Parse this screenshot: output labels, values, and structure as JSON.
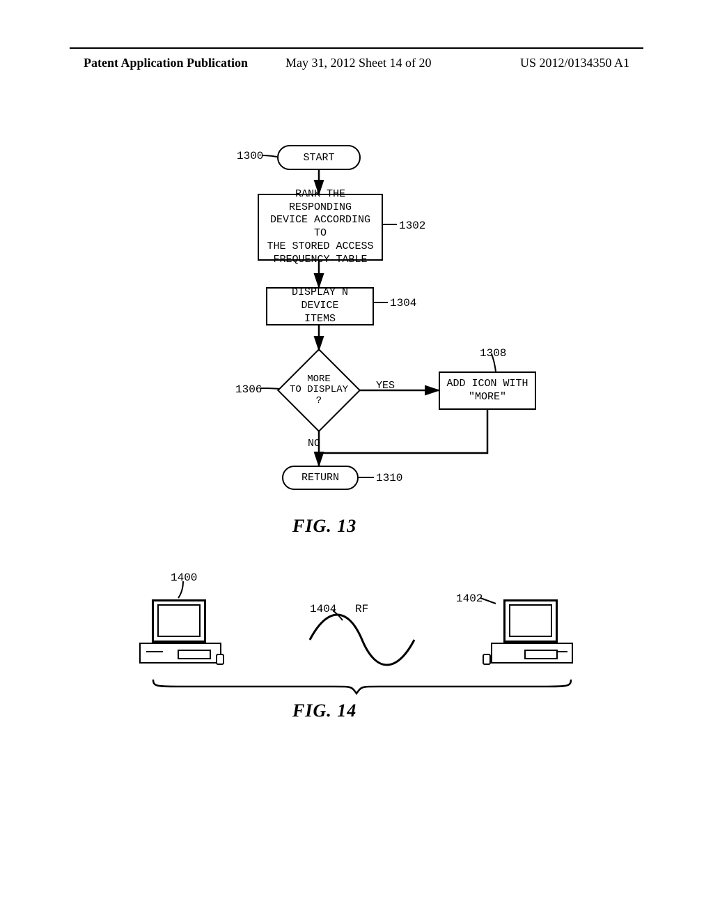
{
  "header": {
    "left": "Patent Application Publication",
    "mid": "May 31, 2012  Sheet 14 of 20",
    "right": "US 2012/0134350 A1"
  },
  "fig13": {
    "start_label": "START",
    "box_rank": "RANK THE RESPONDING\nDEVICE ACCORDING TO\nTHE STORED ACCESS\nFREQUENCY TABLE",
    "box_display": "DISPLAY N DEVICE\nITEMS",
    "decision": "MORE\nTO DISPLAY\n?",
    "decision_yes": "YES",
    "decision_no": "NO",
    "box_more": "ADD ICON WITH\n\"MORE\"",
    "return_label": "RETURN",
    "ref_1300": "1300",
    "ref_1302": "1302",
    "ref_1304": "1304",
    "ref_1306": "1306",
    "ref_1308": "1308",
    "ref_1310": "1310",
    "caption": "FIG. 13"
  },
  "fig14": {
    "ref_1400": "1400",
    "ref_1402": "1402",
    "ref_1404": "1404",
    "rf_label": "RF",
    "caption": "FIG. 14"
  }
}
